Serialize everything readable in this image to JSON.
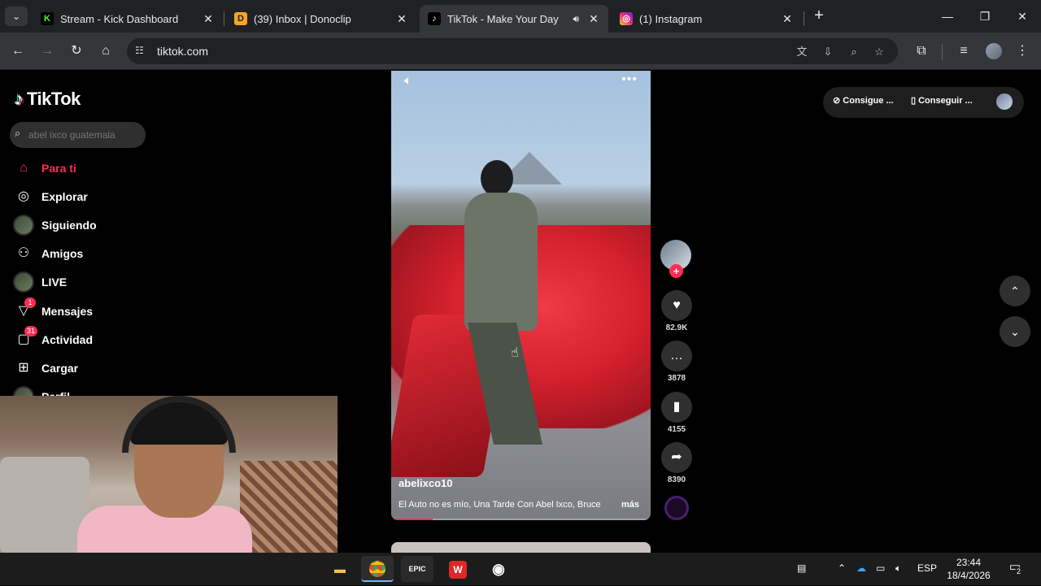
{
  "browser": {
    "tabs": [
      {
        "title": "Stream - Kick Dashboard",
        "favicon": "K",
        "favicon_color": "#53fc18"
      },
      {
        "title": "(39) Inbox | Donoclip",
        "favicon": "D",
        "favicon_color": "#f5a623"
      },
      {
        "title": "TikTok - Make Your Day",
        "favicon": "♪",
        "favicon_color": "#000000",
        "active": true
      },
      {
        "title": "(1) Instagram",
        "favicon": "◎",
        "favicon_color": "#e1306c"
      }
    ],
    "url": "tiktok.com"
  },
  "tiktok": {
    "logo_text": "TikTok",
    "search_placeholder": "abel ixco guatemala",
    "nav": [
      {
        "label": "Para ti",
        "icon": "home-icon",
        "active": true
      },
      {
        "label": "Explorar",
        "icon": "compass-icon"
      },
      {
        "label": "Siguiendo",
        "icon": "following-avatar-icon"
      },
      {
        "label": "Amigos",
        "icon": "friends-icon"
      },
      {
        "label": "LIVE",
        "icon": "live-avatar-icon"
      },
      {
        "label": "Mensajes",
        "icon": "messages-icon",
        "badge": "1"
      },
      {
        "label": "Actividad",
        "icon": "activity-icon",
        "badge": "31"
      },
      {
        "label": "Cargar",
        "icon": "upload-icon"
      },
      {
        "label": "Perfil",
        "icon": "profile-icon"
      }
    ],
    "video": {
      "author": "abelixco10",
      "description": "El Auto no es mío, Una Tarde Con Abel Ixco, Bruce",
      "more_label": "más",
      "progress": 0.16
    },
    "actions": {
      "likes": "82.9K",
      "comments": "3878",
      "saves": "4155",
      "shares": "8390"
    },
    "top_right": {
      "coins_label": "Consigue ...",
      "app_label": "Conseguir ..."
    }
  },
  "taskbar": {
    "language": "ESP",
    "time": "23:44",
    "date": "18/4/2026",
    "notifications": "2",
    "apps": [
      "Explorador de archivos",
      "Google Chrome",
      "EPIC GAMES",
      "WPS Office",
      "OBS Studio"
    ]
  },
  "colors": {
    "tiktok_accent": "#fe2c55",
    "browser_bg": "#202124",
    "toolbar_bg": "#35363a"
  }
}
